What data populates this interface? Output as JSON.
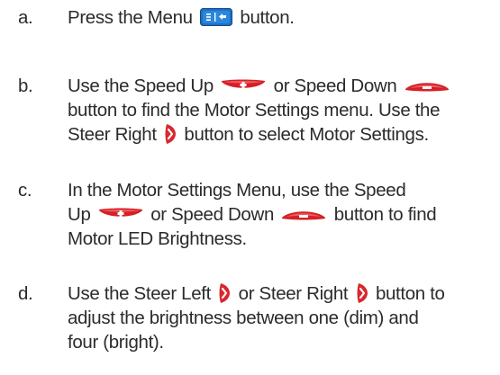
{
  "colors": {
    "text": "#2b2b2b",
    "speed_red": "#d42027",
    "steer_red": "#d8282e",
    "menu_blue": "#1e6fc1"
  },
  "icons": {
    "menu": "menu-button-icon",
    "speed_up": "speed-up-plus-icon",
    "speed_down": "speed-down-minus-icon",
    "steer_right": "steer-right-icon",
    "steer_left": "steer-left-icon"
  },
  "steps": [
    {
      "letter": "a.",
      "lines": [
        [
          "Press the Menu",
          "button."
        ]
      ]
    },
    {
      "letter": "b.",
      "lines": [
        [
          "Use the Speed Up",
          "or Speed Down"
        ],
        [
          "button to find the Motor Settings menu. Use the"
        ],
        [
          "Steer Right",
          "button to select Motor Settings."
        ]
      ]
    },
    {
      "letter": "c.",
      "lines": [
        [
          "In the Motor Settings Menu, use the Speed"
        ],
        [
          "Up",
          "or Speed Down",
          "button to find"
        ],
        [
          "Motor LED Brightness."
        ]
      ]
    },
    {
      "letter": "d.",
      "lines": [
        [
          "Use the Steer Left",
          "or Steer Right",
          "button to"
        ],
        [
          "adjust the brightness between one (dim) and"
        ],
        [
          "four (bright)."
        ]
      ]
    }
  ]
}
